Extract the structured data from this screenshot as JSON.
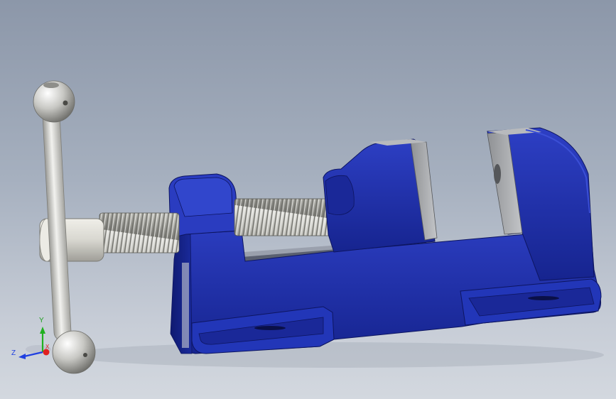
{
  "viewport": {
    "background_top": "#8c97a9",
    "background_bottom": "#d3d8df"
  },
  "model": {
    "body_color": "#1e2fa8",
    "body_highlight": "#3b4fd6",
    "body_shadow": "#0f1a70",
    "jaw_plate_color": "#a6a8ab",
    "handle_color": "#d9d9d6",
    "screw_color": "#c9c9c4"
  },
  "triad": {
    "x_label": "X",
    "y_label": "Y",
    "z_label": "Z",
    "x_color": "#e02020",
    "y_color": "#20b020",
    "z_color": "#2040e0"
  }
}
